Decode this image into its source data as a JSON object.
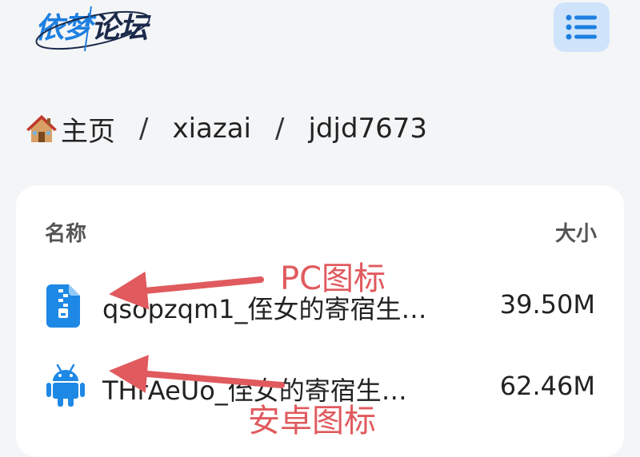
{
  "header": {
    "logo_part1": "依梦",
    "logo_part2": "论坛",
    "menu_icon": "list-menu-icon"
  },
  "breadcrumb": {
    "home_icon": "house-emoji-icon",
    "items": [
      "主页",
      "xiazai",
      "jdjd7673"
    ],
    "separator": "/"
  },
  "file_table": {
    "columns": {
      "name": "名称",
      "size": "大小"
    },
    "rows": [
      {
        "icon": "zip-file-icon",
        "name": "qsopzqm1_侄女的寄宿生…",
        "size": "39.50M"
      },
      {
        "icon": "android-icon",
        "name": "THrAeUo_侄女的寄宿生…",
        "size": "62.46M"
      }
    ]
  },
  "annotations": {
    "pc_label": "PC图标",
    "android_label": "安卓图标",
    "color": "#e05a5e"
  },
  "colors": {
    "accent_blue": "#1e7fe0",
    "menu_bg": "#cfe4fb",
    "page_bg": "#f4f5f7"
  }
}
